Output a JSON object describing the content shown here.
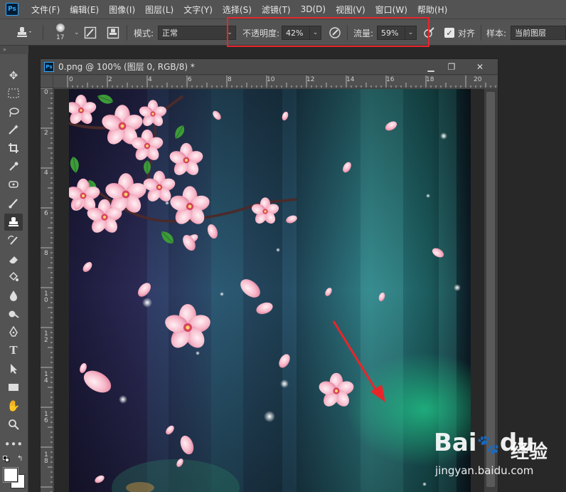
{
  "app": {
    "logo": "Ps"
  },
  "menu": [
    "文件(F)",
    "编辑(E)",
    "图像(I)",
    "图层(L)",
    "文字(Y)",
    "选择(S)",
    "滤镜(T)",
    "3D(D)",
    "视图(V)",
    "窗口(W)",
    "帮助(H)"
  ],
  "options": {
    "brush_size": "17",
    "mode_label": "模式:",
    "mode_value": "正常",
    "opacity_label": "不透明度:",
    "opacity_value": "42%",
    "flow_label": "流量:",
    "flow_value": "59%",
    "aligned_label": "对齐",
    "aligned_checked": true,
    "sample_label": "样本:",
    "sample_value": "当前图层"
  },
  "tools": [
    "move-icon",
    "marquee-icon",
    "lasso-icon",
    "magic-wand-icon",
    "crop-icon",
    "eyedropper-icon",
    "healing-icon",
    "brush-icon",
    "clone-stamp-icon",
    "history-brush-icon",
    "eraser-icon",
    "paint-bucket-icon",
    "blur-icon",
    "dodge-icon",
    "pen-icon",
    "type-icon",
    "path-select-icon",
    "rectangle-icon",
    "hand-icon",
    "zoom-icon",
    "more-tools-icon"
  ],
  "document": {
    "tab_icon": "Ps",
    "title": "0.png @ 100% (图层 0, RGB/8) *",
    "ruler_top": [
      "0",
      "2",
      "4",
      "6",
      "8",
      "10",
      "12",
      "14",
      "16",
      "18",
      "20"
    ],
    "ruler_left": [
      "0",
      "2",
      "4",
      "6",
      "8",
      "10",
      "12",
      "14",
      "16",
      "18"
    ]
  },
  "watermark": {
    "logo": "Bai",
    "logo2": "du",
    "cn": "经验",
    "url": "jingyan.baidu.com"
  },
  "colors": {
    "highlight": "#e8262a",
    "arrow": "#e8262a",
    "panel": "#535353",
    "canvas_bg": "#282828",
    "ps_blue": "#31a8ff"
  }
}
